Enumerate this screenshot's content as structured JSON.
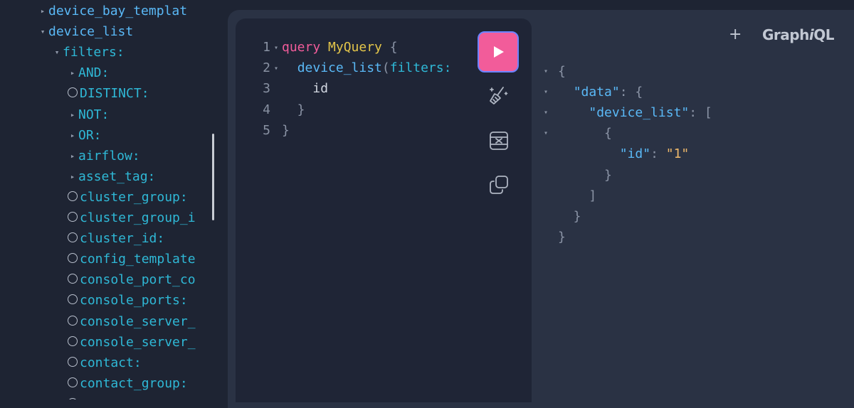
{
  "explorer": {
    "items": [
      {
        "label": "device_bay_templat",
        "control": "arrow-right",
        "kind": "field",
        "depth": 0
      },
      {
        "label": "device_list",
        "control": "arrow-down",
        "kind": "field",
        "depth": 0
      },
      {
        "label": "filters:",
        "control": "arrow-down",
        "kind": "arg",
        "depth": 1
      },
      {
        "label": "AND:",
        "control": "arrow-right",
        "kind": "arg",
        "depth": 2
      },
      {
        "label": "DISTINCT:",
        "control": "circle",
        "kind": "arg",
        "depth": 2
      },
      {
        "label": "NOT:",
        "control": "arrow-right",
        "kind": "arg",
        "depth": 2
      },
      {
        "label": "OR:",
        "control": "arrow-right",
        "kind": "arg",
        "depth": 2
      },
      {
        "label": "airflow:",
        "control": "arrow-right",
        "kind": "arg",
        "depth": 2
      },
      {
        "label": "asset_tag:",
        "control": "arrow-right",
        "kind": "arg",
        "depth": 2
      },
      {
        "label": "cluster_group:",
        "control": "circle",
        "kind": "arg",
        "depth": 2
      },
      {
        "label": "cluster_group_i",
        "control": "circle",
        "kind": "arg",
        "depth": 2
      },
      {
        "label": "cluster_id:",
        "control": "circle",
        "kind": "arg",
        "depth": 2
      },
      {
        "label": "config_template",
        "control": "circle",
        "kind": "arg",
        "depth": 2
      },
      {
        "label": "console_port_co",
        "control": "circle",
        "kind": "arg",
        "depth": 2
      },
      {
        "label": "console_ports:",
        "control": "circle",
        "kind": "arg",
        "depth": 2
      },
      {
        "label": "console_server_",
        "control": "circle",
        "kind": "arg",
        "depth": 2
      },
      {
        "label": "console_server_",
        "control": "circle",
        "kind": "arg",
        "depth": 2
      },
      {
        "label": "contact:",
        "control": "circle",
        "kind": "arg",
        "depth": 2
      },
      {
        "label": "contact_group:",
        "control": "circle",
        "kind": "arg",
        "depth": 2
      },
      {
        "label": "",
        "control": "circle",
        "kind": "arg",
        "depth": 2
      }
    ]
  },
  "editor": {
    "lines": [
      {
        "num": "1",
        "fold": true,
        "tokens": [
          {
            "t": "query",
            "c": "kw"
          },
          {
            "t": " ",
            "c": "tx"
          },
          {
            "t": "MyQuery",
            "c": "nm"
          },
          {
            "t": " {",
            "c": "pn"
          }
        ]
      },
      {
        "num": "2",
        "fold": true,
        "tokens": [
          {
            "t": "  ",
            "c": "tx"
          },
          {
            "t": "device_list",
            "c": "fld"
          },
          {
            "t": "(",
            "c": "pn"
          },
          {
            "t": "filters:",
            "c": "arg"
          }
        ]
      },
      {
        "num": "3",
        "fold": false,
        "tokens": [
          {
            "t": "    ",
            "c": "tx"
          },
          {
            "t": "id",
            "c": "tx"
          }
        ]
      },
      {
        "num": "4",
        "fold": false,
        "tokens": [
          {
            "t": "  }",
            "c": "pn"
          }
        ]
      },
      {
        "num": "5",
        "fold": false,
        "tokens": [
          {
            "t": "}",
            "c": "pn"
          }
        ]
      }
    ]
  },
  "toolbar": {
    "run": "play-icon",
    "prettify": "prettify-icon",
    "merge": "merge-fragments-icon",
    "copy": "copy-icon"
  },
  "header": {
    "add_tab": "+",
    "logo_prefix": "Graph",
    "logo_italic": "i",
    "logo_suffix": "QL"
  },
  "response": {
    "lines": [
      {
        "fold": true,
        "tokens": [
          {
            "t": "{",
            "c": "pn"
          }
        ]
      },
      {
        "fold": true,
        "tokens": [
          {
            "t": "  ",
            "c": "tx"
          },
          {
            "t": "\"data\"",
            "c": "key"
          },
          {
            "t": ": {",
            "c": "pn"
          }
        ]
      },
      {
        "fold": true,
        "tokens": [
          {
            "t": "    ",
            "c": "tx"
          },
          {
            "t": "\"device_list\"",
            "c": "key"
          },
          {
            "t": ": [",
            "c": "pn"
          }
        ]
      },
      {
        "fold": true,
        "tokens": [
          {
            "t": "      {",
            "c": "pn"
          }
        ]
      },
      {
        "fold": false,
        "tokens": [
          {
            "t": "        ",
            "c": "tx"
          },
          {
            "t": "\"id\"",
            "c": "key"
          },
          {
            "t": ": ",
            "c": "pn"
          },
          {
            "t": "\"1\"",
            "c": "str"
          }
        ]
      },
      {
        "fold": false,
        "tokens": [
          {
            "t": "      }",
            "c": "pn"
          }
        ]
      },
      {
        "fold": false,
        "tokens": [
          {
            "t": "    ]",
            "c": "pn"
          }
        ]
      },
      {
        "fold": false,
        "tokens": [
          {
            "t": "  }",
            "c": "pn"
          }
        ]
      },
      {
        "fold": false,
        "tokens": [
          {
            "t": "}",
            "c": "pn"
          }
        ]
      }
    ]
  },
  "colors": {
    "accent": "#f25c9a",
    "field": "#5ab9f7",
    "argument": "#2fb8d6",
    "keyword": "#f25c9a",
    "name": "#e4c64a",
    "string": "#f0b96b"
  }
}
